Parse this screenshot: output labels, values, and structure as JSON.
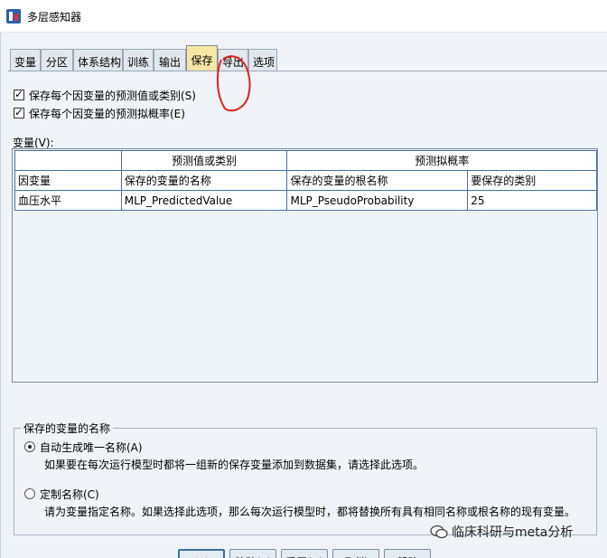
{
  "window": {
    "title": "多层感知器"
  },
  "tabs": [
    {
      "label": "变量"
    },
    {
      "label": "分区"
    },
    {
      "label": "体系结构"
    },
    {
      "label": "训练"
    },
    {
      "label": "输出"
    },
    {
      "label": "保存"
    },
    {
      "label": "导出"
    },
    {
      "label": "选项"
    }
  ],
  "active_tab": "保存",
  "options": {
    "save_predicted": {
      "label": "保存每个因变量的预测值或类别(S)",
      "checked": true
    },
    "save_probability": {
      "label": "保存每个因变量的预测拟概率(E)",
      "checked": true
    }
  },
  "variables": {
    "label": "变量(V):",
    "group_headers": [
      "",
      "预测值或类别",
      "预测拟概率"
    ],
    "columns": [
      "因变量",
      "保存的变量的名称",
      "保存的变量的根名称",
      "要保存的类别"
    ],
    "rows": [
      [
        "血压水平",
        "MLP_PredictedValue",
        "MLP_PseudoProbability",
        "25"
      ]
    ]
  },
  "naming": {
    "title": "保存的变量的名称",
    "auto": {
      "label": "自动生成唯一名称(A)",
      "desc": "如果要在每次运行模型时都将一组新的保存变量添加到数据集，请选择此选项。",
      "selected": true
    },
    "custom": {
      "label": "定制名称(C)",
      "desc": "请为变量指定名称。如果选择此选项，那么每次运行模型时，都将替换所有具有相同名称或根名称的现有变量。",
      "selected": false
    }
  },
  "buttons": [
    "确定",
    "粘贴(P)",
    "重置(R)",
    "取消",
    "帮助"
  ],
  "watermark": "临床科研与meta分析",
  "colors": {
    "dialog_bg": "#f0f3f7",
    "active_tab_bg": "#f6e7a4",
    "grid_border": "#4a6fa5",
    "annotation_red": "#e02020"
  }
}
